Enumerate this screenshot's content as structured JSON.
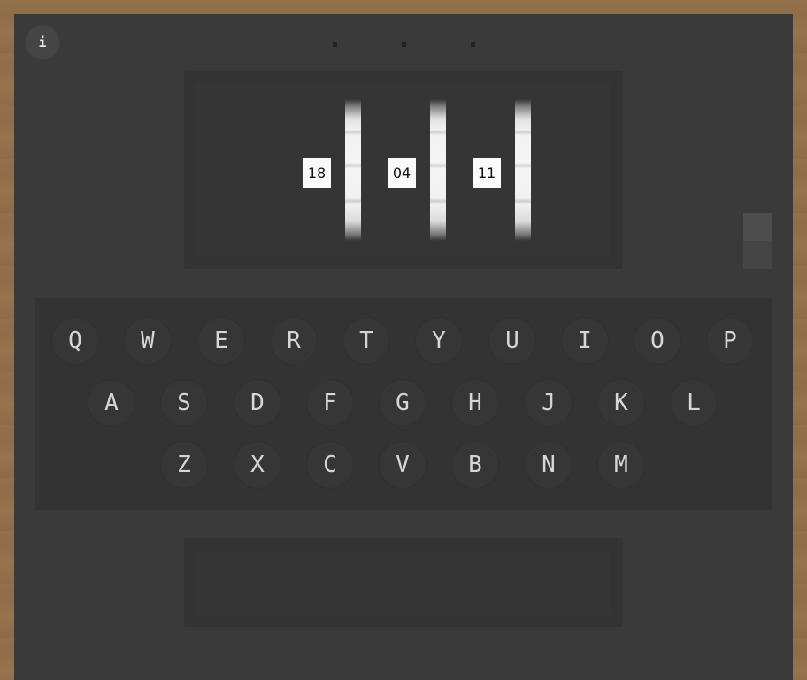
{
  "info_button": {
    "label": "i"
  },
  "rotors": [
    {
      "position": "18"
    },
    {
      "position": "04"
    },
    {
      "position": "11"
    }
  ],
  "keyboard": {
    "rows": [
      [
        "Q",
        "W",
        "E",
        "R",
        "T",
        "Y",
        "U",
        "I",
        "O",
        "P"
      ],
      [
        "A",
        "S",
        "D",
        "F",
        "G",
        "H",
        "J",
        "K",
        "L"
      ],
      [
        "Z",
        "X",
        "C",
        "V",
        "B",
        "N",
        "M"
      ]
    ]
  },
  "output": {
    "text": ""
  },
  "colors": {
    "frame": "#92704a",
    "machine": "#3a3a3a",
    "panel": "#333333",
    "key_text": "#d6d6d6",
    "rotor_window": "#fafafa"
  }
}
